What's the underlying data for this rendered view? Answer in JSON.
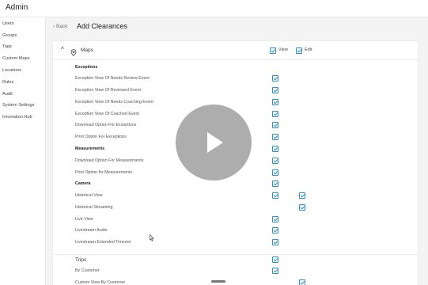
{
  "app": {
    "title": "Admin"
  },
  "sidebar": {
    "items": [
      {
        "label": "Users"
      },
      {
        "label": "Groups"
      },
      {
        "label": "Tags"
      },
      {
        "label": "Custom Maps"
      },
      {
        "label": "Locations"
      },
      {
        "label": "Rules"
      },
      {
        "label": "Audit"
      },
      {
        "label": "System Settings"
      },
      {
        "label": "Innovation Hub"
      }
    ]
  },
  "header": {
    "back_label": "Back",
    "page_title": "Add Clearances"
  },
  "section": {
    "title": "Maps",
    "view_label": "View",
    "edit_label": "Edit",
    "view_checked": true,
    "edit_checked": true
  },
  "rows": [
    {
      "label": "Exceptions",
      "type": "heading",
      "view": false,
      "edit": false
    },
    {
      "label": "Exception View Of Needs Review Event",
      "type": "item",
      "view": true,
      "edit": false
    },
    {
      "label": "Exception View Of Reviewed Event",
      "type": "item",
      "view": true,
      "edit": false
    },
    {
      "label": "Exception View Of Needs Coaching Event",
      "type": "item",
      "view": true,
      "edit": false
    },
    {
      "label": "Exception View Of Coached Event",
      "type": "item",
      "view": true,
      "edit": false
    },
    {
      "label": "Download Option For Exceptions",
      "type": "item",
      "view": true,
      "edit": false
    },
    {
      "label": "Print Option For Exceptions",
      "type": "item",
      "view": true,
      "edit": false
    },
    {
      "label": "Measurements",
      "type": "heading",
      "view": true,
      "edit": false
    },
    {
      "label": "Download Option For Measurements",
      "type": "item",
      "view": true,
      "edit": false
    },
    {
      "label": "Print Option for Measurements",
      "type": "item",
      "view": true,
      "edit": false
    },
    {
      "label": "Camera",
      "type": "heading",
      "view": true,
      "edit": false
    },
    {
      "label": "Historical View",
      "type": "item",
      "view": true,
      "edit": true
    },
    {
      "label": "Historical Streaming",
      "type": "item",
      "view": false,
      "edit": true
    },
    {
      "label": "Live View",
      "type": "item",
      "view": true,
      "edit": false
    },
    {
      "label": "Livestream Audio",
      "type": "item",
      "view": true,
      "edit": false
    },
    {
      "label": "Livestream Extended Timeout",
      "type": "item",
      "view": true,
      "edit": false
    },
    {
      "label": "Trips",
      "type": "section",
      "view": true,
      "edit": false
    },
    {
      "label": "By Customer",
      "type": "item",
      "view": true,
      "edit": false
    },
    {
      "label": "Custom View By Customer",
      "type": "item",
      "view": false,
      "edit": true
    }
  ],
  "icons": {
    "back": "chevron-left-icon",
    "collapse": "chevron-up-icon",
    "section": "map-pin-icon",
    "play": "play-icon",
    "cursor": "mouse-pointer-icon"
  },
  "colors": {
    "accent": "#2b8fd6",
    "overlay": "#969696"
  }
}
